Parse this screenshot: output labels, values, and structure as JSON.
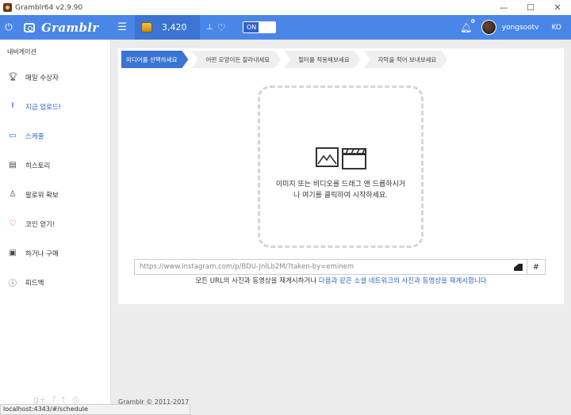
{
  "window": {
    "title": "Gramblr64 v2.9.90",
    "minimize": "—",
    "maximize": "☐",
    "close": "✕"
  },
  "header": {
    "brand": "Gramblr",
    "coins": "3,420",
    "toggle_label": "ON",
    "notifications": "0",
    "username": "yongsootv",
    "language": "KO",
    "accent": "#4a86e8"
  },
  "sidebar": {
    "title": "내비게이션",
    "items": [
      {
        "label": "매일 수상자",
        "icon": "trophy-icon"
      },
      {
        "label": "지금 업로드!",
        "icon": "upload-icon"
      },
      {
        "label": "스케줄",
        "icon": "calendar-icon"
      },
      {
        "label": "히스토리",
        "icon": "history-icon"
      },
      {
        "label": "팔로워 확보",
        "icon": "user-icon"
      },
      {
        "label": "코인 얻기!",
        "icon": "heart-icon"
      },
      {
        "label": "하거나 구매",
        "icon": "wallet-icon"
      },
      {
        "label": "피드백",
        "icon": "question-icon"
      }
    ]
  },
  "steps": [
    "미디어를 선택하세요",
    "어떤 모양이든 잘라내세요",
    "필터를 적용해보세요",
    "자막을 적어 보내보세요"
  ],
  "dropzone": {
    "text": "이미지 또는 비디오를 드래그 앤 드롭하시거나 여기를 클릭하여 시작하세요."
  },
  "url": {
    "placeholder": "https://www.instagram.com/p/BDU-JnlLb2M/?taken-by=eminem",
    "hash": "#"
  },
  "hint": {
    "text": "모든 URL의 사진과 동영상을 재게시하거나 ",
    "link": "다음과 같은 소셜 네트워크의 사진과 동영상을 재게시합니다"
  },
  "status_url": "localhost:4343/#/schedule",
  "footer": "Gramblr © 2011-2017"
}
